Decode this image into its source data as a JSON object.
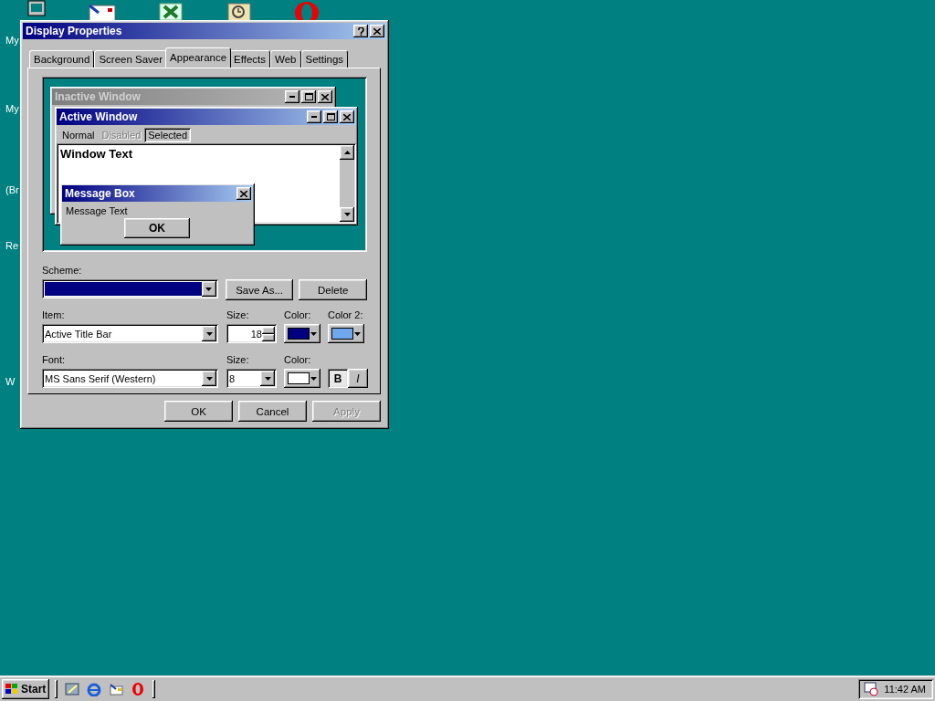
{
  "desktop": {
    "labels": [
      "My",
      "My",
      "(Br",
      "Re",
      "W"
    ]
  },
  "dialog": {
    "title": "Display Properties",
    "tabs": [
      {
        "label": "Background",
        "selected": false
      },
      {
        "label": "Screen Saver",
        "selected": false
      },
      {
        "label": "Appearance",
        "selected": true
      },
      {
        "label": "Effects",
        "selected": false
      },
      {
        "label": "Web",
        "selected": false
      },
      {
        "label": "Settings",
        "selected": false
      }
    ],
    "preview": {
      "inactive_title": "Inactive Window",
      "active_title": "Active Window",
      "menu": [
        {
          "label": "Normal",
          "disabled": false,
          "selected": false
        },
        {
          "label": "Disabled",
          "disabled": true,
          "selected": false
        },
        {
          "label": "Selected",
          "disabled": false,
          "selected": true
        }
      ],
      "window_text": "Window Text",
      "message_box": {
        "title": "Message Box",
        "text": "Message Text",
        "button": "OK"
      }
    },
    "scheme": {
      "label": "Scheme:",
      "color": "#000080",
      "buttons": [
        "Save As...",
        "Delete"
      ]
    },
    "item": {
      "label": "Item:",
      "value": "Active Title Bar",
      "size_label": "Size:",
      "size": "18",
      "color_label": "Color:",
      "color": "#000080",
      "color2_label": "Color 2:",
      "color2": {
        "color": "#70a8f0"
      }
    },
    "font": {
      "label": "Font:",
      "value": "MS Sans Serif (Western)",
      "size_label": "Size:",
      "size": "8",
      "color_label": "Color:",
      "color": "#ffffff",
      "bold_label": "B",
      "bold": true,
      "italic_label": "I",
      "italic": false
    },
    "buttons": [
      {
        "label": "OK",
        "disabled": false
      },
      {
        "label": "Cancel",
        "disabled": false
      },
      {
        "label": "Apply",
        "disabled": true
      }
    ]
  },
  "taskbar": {
    "start": "Start",
    "clock": "11:42 AM"
  }
}
